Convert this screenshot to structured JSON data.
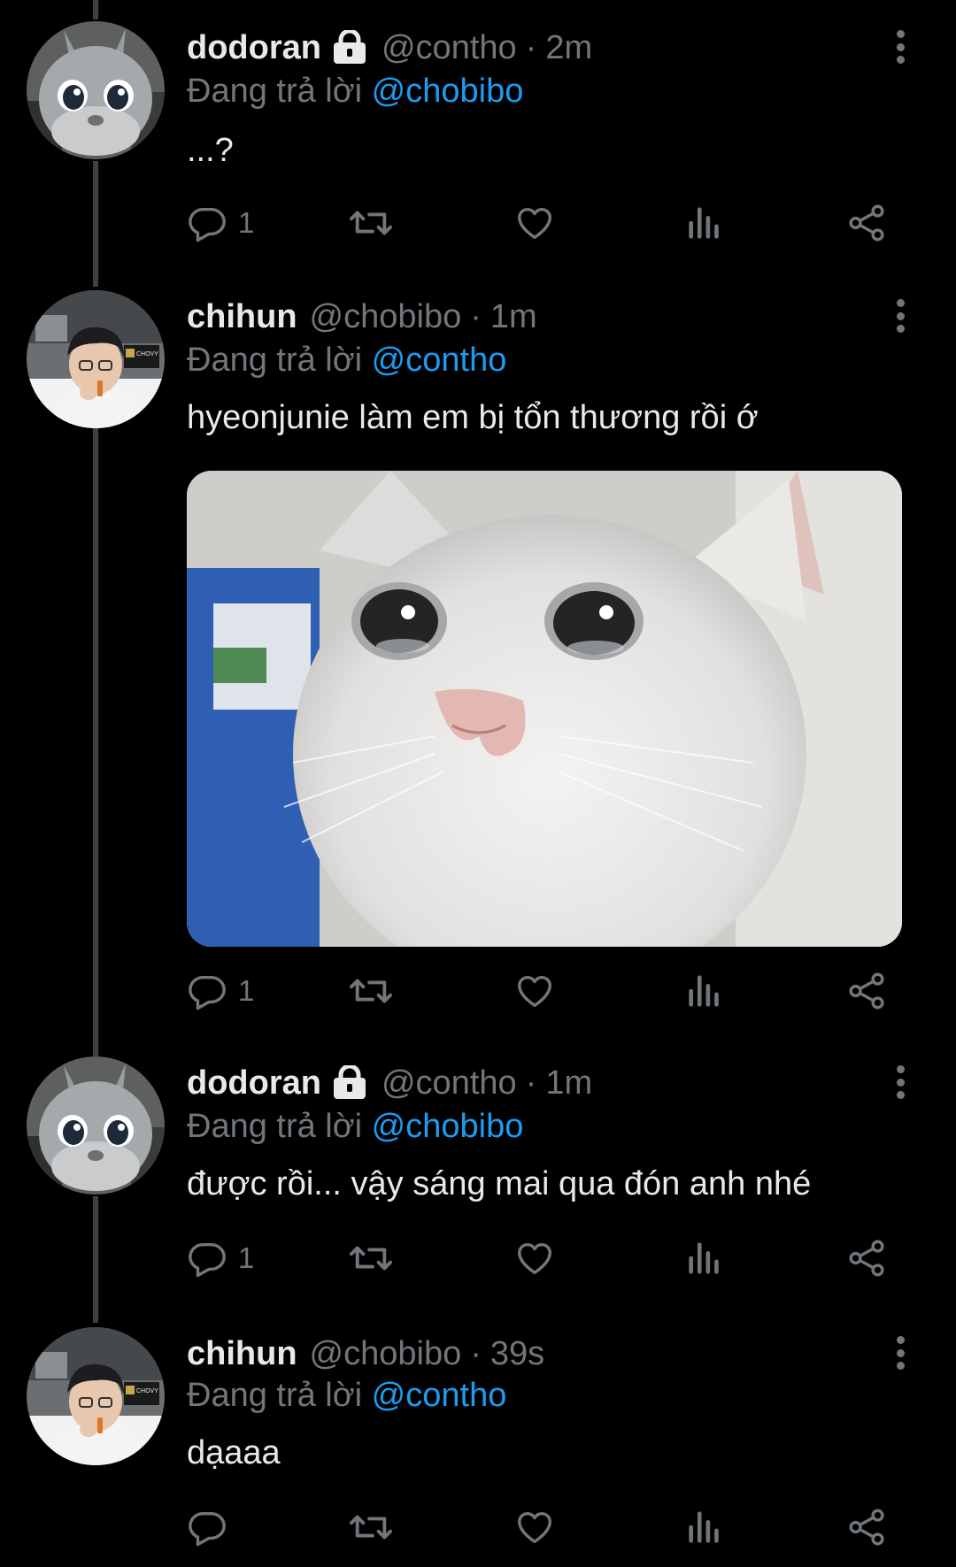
{
  "colors": {
    "background": "#000000",
    "text": "#e7e9ea",
    "muted": "#71767b",
    "accent": "#1d9bf0",
    "thread_line": "#3e4144"
  },
  "tweets": [
    {
      "display_name": "dodoran",
      "locked": true,
      "handle": "@contho",
      "separator": "·",
      "time": "2m",
      "reply_prefix": "Đang trả lời",
      "reply_to": "@chobibo",
      "text": "...?",
      "reply_count": "1",
      "avatar": "bunny-mascot-avatar"
    },
    {
      "display_name": "chihun",
      "locked": false,
      "handle": "@chobibo",
      "separator": "·",
      "time": "1m",
      "reply_prefix": "Đang trả lời",
      "reply_to": "@contho",
      "text": "hyeonjunie làm em bị tổn thương rồi ớ",
      "reply_count": "1",
      "avatar": "streamer-avatar",
      "media": "crying-cat-image"
    },
    {
      "display_name": "dodoran",
      "locked": true,
      "handle": "@contho",
      "separator": "·",
      "time": "1m",
      "reply_prefix": "Đang trả lời",
      "reply_to": "@chobibo",
      "text": "được rồi... vậy sáng mai qua đón anh nhé",
      "reply_count": "1",
      "avatar": "bunny-mascot-avatar"
    },
    {
      "display_name": "chihun",
      "locked": false,
      "handle": "@chobibo",
      "separator": "·",
      "time": "39s",
      "reply_prefix": "Đang trả lời",
      "reply_to": "@contho",
      "text": "dạaaa",
      "reply_count": "",
      "avatar": "streamer-avatar"
    }
  ],
  "icons": {
    "reply": "reply-icon",
    "retweet": "retweet-icon",
    "like": "heart-icon",
    "views": "views-icon",
    "share": "share-icon",
    "more": "more-icon",
    "lock": "lock-icon"
  }
}
